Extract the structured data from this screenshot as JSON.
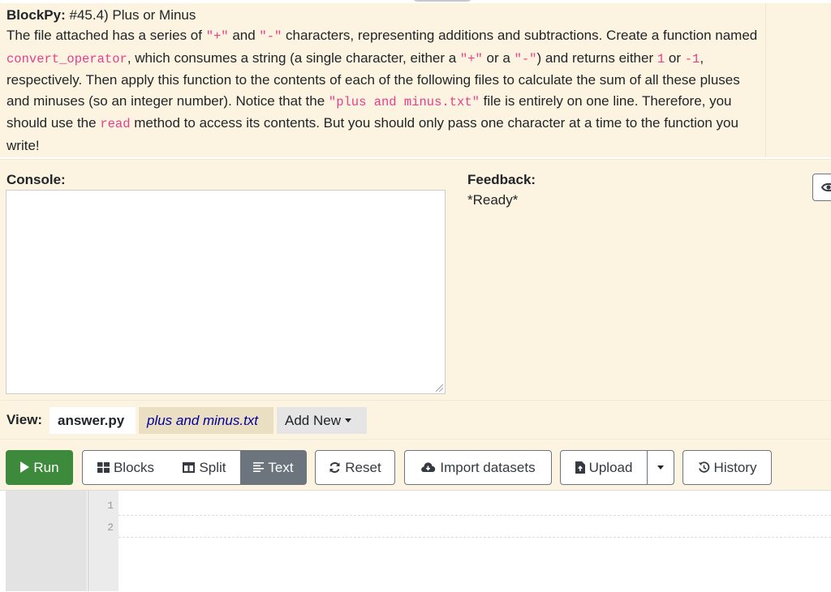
{
  "assignment": {
    "label": "BlockPy:",
    "title": "#45.4) Plus or Minus",
    "body": {
      "t1": "The file attached has a series of ",
      "c_plus": "\"+\"",
      "t2": " and ",
      "c_minus": "\"-\"",
      "t3": " characters, representing additions and subtractions. Create a function named ",
      "c_func": "convert_operator",
      "t4": ", which consumes a string (a single character, either a ",
      "c_plus2": "\"+\"",
      "t5": " or a ",
      "c_minus2": "\"-\"",
      "t6": ") and returns either ",
      "c_one": "1",
      "t7": " or ",
      "c_neg_one": "-1",
      "t8": ", respectively. Then apply this function to the contents of each of the following files to calculate the sum of all these pluses and minuses (so an integer number). Notice that the ",
      "c_file": "\"plus and minus.txt\"",
      "t9": " file is entirely on one line. Therefore, you should use the ",
      "c_read": "read",
      "t10": " method to access its contents. But you should only pass one character at a time to the function you write!"
    }
  },
  "console": {
    "label": "Console:",
    "value": ""
  },
  "feedback": {
    "label": "Feedback:",
    "status": "*Ready*"
  },
  "view": {
    "label": "View:",
    "tabs": [
      "answer.py",
      "plus and minus.txt"
    ],
    "add_new": "Add New"
  },
  "toolbar": {
    "run": "Run",
    "blocks": "Blocks",
    "split": "Split",
    "text": "Text",
    "reset": "Reset",
    "import": "Import datasets",
    "upload": "Upload",
    "history": "History"
  },
  "editor": {
    "line_numbers": [
      "1",
      "2"
    ]
  },
  "colors": {
    "run_green": "#3d8a3d",
    "panel_bg": "#fcf4e0",
    "code_pink": "#e83e8c",
    "file_tab_blue": "#00009c"
  }
}
